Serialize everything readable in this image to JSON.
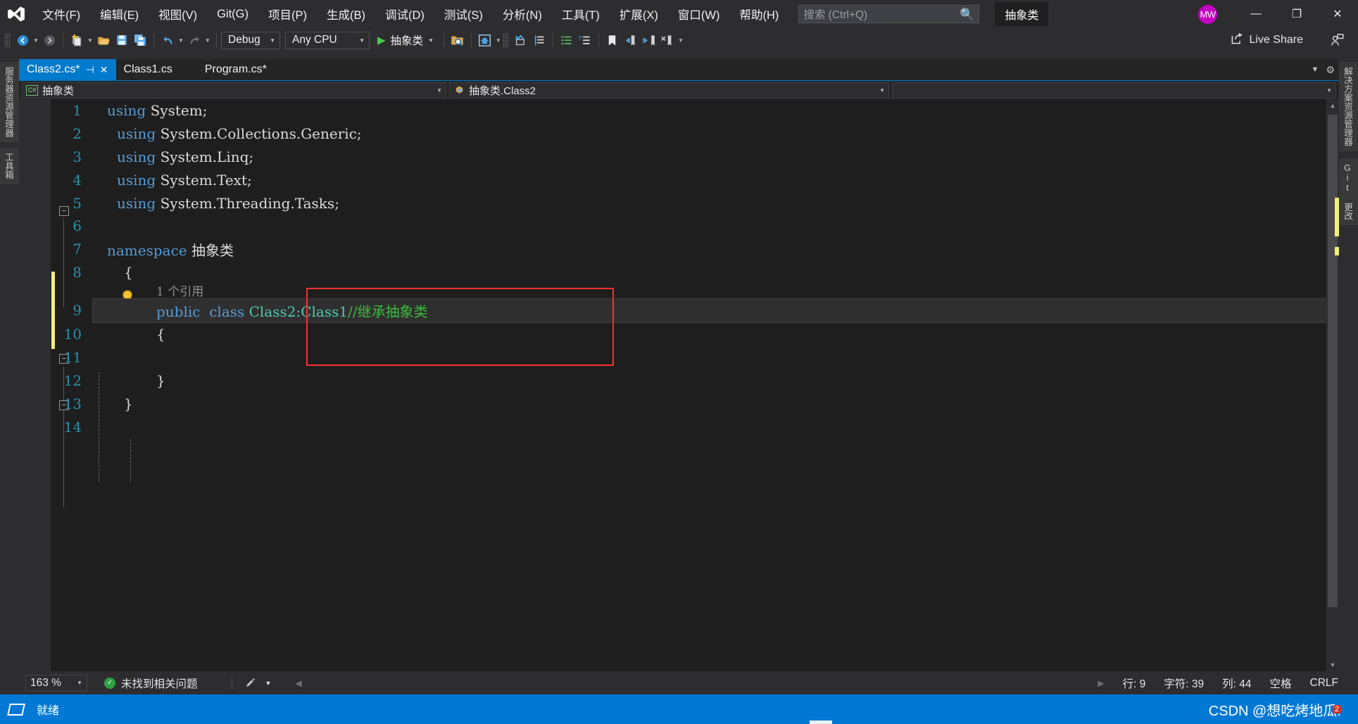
{
  "app": {
    "logo": "visual-studio-logo",
    "project_badge": "抽象类"
  },
  "menu": {
    "items": [
      {
        "label": "文件(F)"
      },
      {
        "label": "编辑(E)"
      },
      {
        "label": "视图(V)"
      },
      {
        "label": "Git(G)"
      },
      {
        "label": "项目(P)"
      },
      {
        "label": "生成(B)"
      },
      {
        "label": "调试(D)"
      },
      {
        "label": "测试(S)"
      },
      {
        "label": "分析(N)"
      },
      {
        "label": "工具(T)"
      },
      {
        "label": "扩展(X)"
      },
      {
        "label": "窗口(W)"
      },
      {
        "label": "帮助(H)"
      }
    ]
  },
  "search": {
    "placeholder": "搜索 (Ctrl+Q)",
    "icon": "search-icon"
  },
  "window": {
    "avatar_initials": "MW",
    "avatar_color": "#c300c3",
    "minimize": "—",
    "restore": "❐",
    "close": "✕"
  },
  "toolbar": {
    "config": {
      "value": "Debug"
    },
    "platform": {
      "value": "Any CPU"
    },
    "run": {
      "label": "抽象类"
    },
    "live_share": {
      "label": "Live Share"
    }
  },
  "rails": {
    "left": [
      {
        "label": "服务器资源管理器"
      },
      {
        "label": "工具箱"
      }
    ],
    "right": [
      {
        "label": "解决方案资源管理器"
      },
      {
        "label": "Git 更改"
      }
    ]
  },
  "tabs": [
    {
      "label": "Class2.cs*",
      "active": true,
      "pin": "⊣",
      "close": "✕"
    },
    {
      "label": "Class1.cs",
      "active": false
    },
    {
      "label": "Program.cs*",
      "active": false
    }
  ],
  "navbar": {
    "project": "抽象类",
    "type": "抽象类.Class2",
    "member": ""
  },
  "editor": {
    "lines": [
      {
        "num": "1",
        "segments": [
          {
            "t": "using ",
            "c": "kw"
          },
          {
            "t": "System;",
            "c": "txt"
          }
        ]
      },
      {
        "num": "2",
        "segments": [
          {
            "t": "using ",
            "c": "kw"
          },
          {
            "t": "System.Collections.Generic;",
            "c": "txt"
          }
        ]
      },
      {
        "num": "3",
        "segments": [
          {
            "t": "using ",
            "c": "kw"
          },
          {
            "t": "System.Linq;",
            "c": "txt"
          }
        ]
      },
      {
        "num": "4",
        "segments": [
          {
            "t": "using ",
            "c": "kw"
          },
          {
            "t": "System.Text;",
            "c": "txt"
          }
        ]
      },
      {
        "num": "5",
        "segments": [
          {
            "t": "using ",
            "c": "kw"
          },
          {
            "t": "System.Threading.Tasks;",
            "c": "txt"
          }
        ]
      },
      {
        "num": "6",
        "segments": []
      },
      {
        "num": "7",
        "segments": [
          {
            "t": "namespace ",
            "c": "kw"
          },
          {
            "t": "抽象类",
            "c": "txt"
          }
        ]
      },
      {
        "num": "8",
        "segments": [
          {
            "t": "{",
            "c": "txt"
          }
        ]
      },
      {
        "num": "9",
        "segments": [
          {
            "t": "public  class ",
            "c": "kw"
          },
          {
            "t": "Class2:Class1",
            "c": "cls"
          },
          {
            "t": "//继承抽象类",
            "c": "cmt"
          }
        ]
      },
      {
        "num": "10",
        "segments": [
          {
            "t": "{",
            "c": "txt"
          }
        ]
      },
      {
        "num": "11",
        "segments": []
      },
      {
        "num": "12",
        "segments": [
          {
            "t": "}",
            "c": "txt"
          }
        ]
      },
      {
        "num": "13",
        "segments": [
          {
            "t": "}",
            "c": "txt"
          }
        ]
      },
      {
        "num": "14",
        "segments": []
      }
    ],
    "codelens": "1 个引用",
    "bulb": "lightbulb-icon"
  },
  "status": {
    "zoom": "163 %",
    "problems": "未找到相关问题",
    "line_label": "行: 9",
    "char_label": "字符: 39",
    "col_label": "列: 44",
    "spaces": "空格",
    "eol": "CRLF"
  },
  "taskbar": {
    "ready": "就绪",
    "watermark": "CSDN @想吃烤地瓜.",
    "watermark_badge": "2"
  },
  "colors": {
    "accent": "#007acc",
    "taskbar": "#0078d4",
    "editor_bg": "#1e1e1e",
    "chrome_bg": "#2d2d30",
    "keyword": "#569cd6",
    "class": "#4ec9b0",
    "comment": "#3dbb3d",
    "linenum": "#2b91af",
    "annotation": "#ff2e2e"
  }
}
